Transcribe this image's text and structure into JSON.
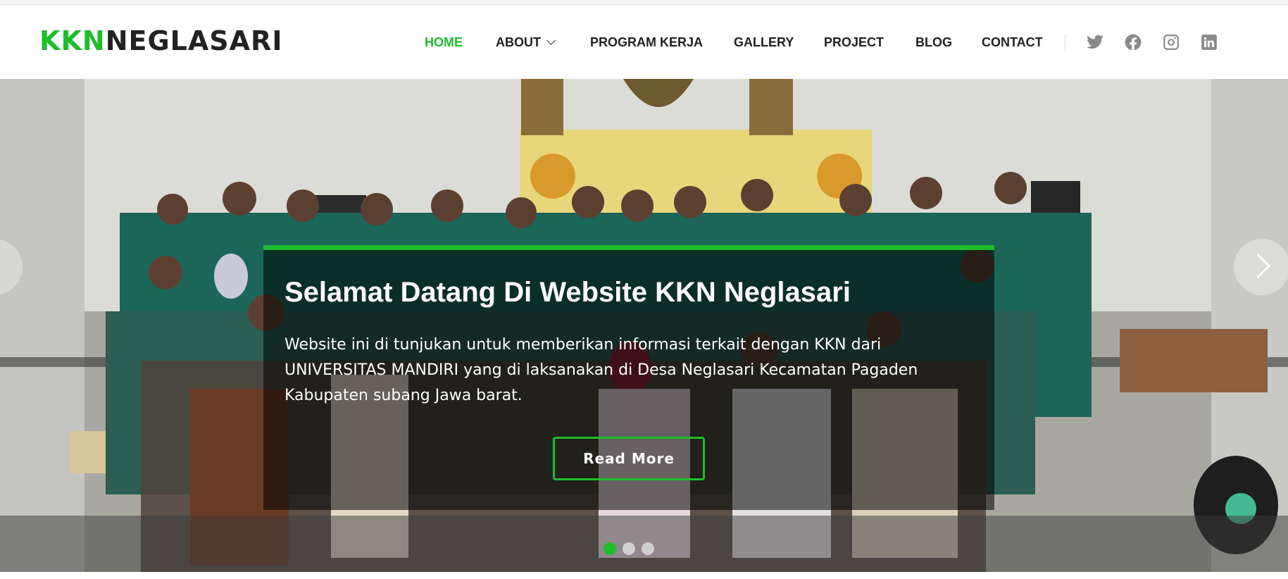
{
  "brand": {
    "accent": "KKN",
    "name": "NEGLASARI"
  },
  "nav": {
    "items": [
      {
        "label": "HOME",
        "active": true
      },
      {
        "label": "ABOUT",
        "has_dropdown": true
      },
      {
        "label": "PROGRAM KERJA"
      },
      {
        "label": "GALLERY"
      },
      {
        "label": "PROJECT"
      },
      {
        "label": "BLOG"
      },
      {
        "label": "CONTACT"
      }
    ],
    "social_icons": [
      "twitter-icon",
      "facebook-icon",
      "instagram-icon",
      "linkedin-icon"
    ]
  },
  "hero": {
    "title": "Selamat Datang Di Website KKN Neglasari",
    "description": "Website ini di tunjukan untuk memberikan informasi terkait dengan KKN dari UNIVERSITAS MANDIRI yang di laksanakan di Desa Neglasari Kecamatan Pagaden Kabupaten subang Jawa barat.",
    "button_label": "Read More",
    "slides_total": 3,
    "active_slide": 1
  },
  "colors": {
    "accent": "#1ebd2b",
    "text_dark": "#222222",
    "icon_gray": "#8a8a8a",
    "overlay": "rgba(0,0,0,0.55)"
  }
}
